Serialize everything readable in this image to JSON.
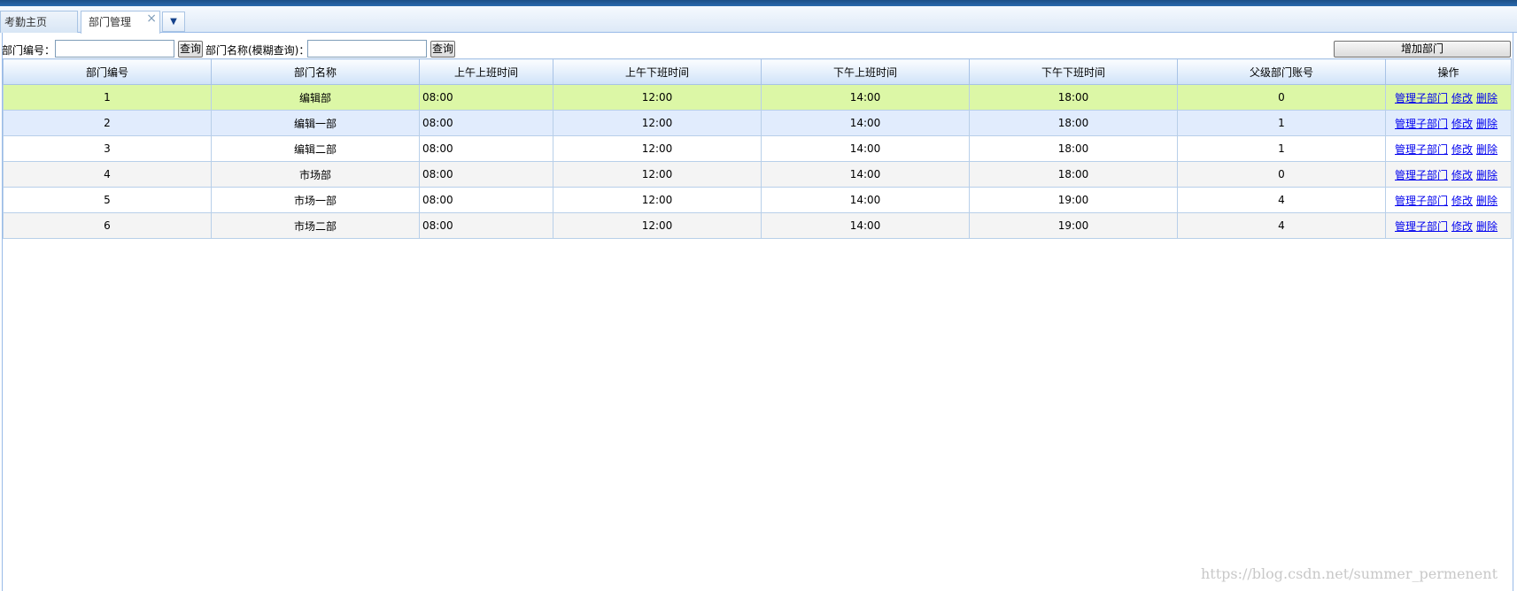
{
  "tabs": [
    {
      "label": "考勤主页",
      "active": false
    },
    {
      "label": "部门管理",
      "active": true
    }
  ],
  "toolbar": {
    "dept_id_label": "部门编号：",
    "dept_id_value": "",
    "search_btn_1": "查询",
    "dept_name_label": "部门名称(模糊查询)：",
    "dept_name_value": "",
    "search_btn_2": "查询",
    "add_btn": "增加部门"
  },
  "table": {
    "columns": [
      "部门编号",
      "部门名称",
      "上午上班时间",
      "上午下班时间",
      "下午上班时间",
      "下午下班时间",
      "父级部门账号",
      "操作"
    ],
    "rows": [
      {
        "id": "1",
        "name": "编辑部",
        "am_in": "08:00",
        "am_out": "12:00",
        "pm_in": "14:00",
        "pm_out": "18:00",
        "parent": "0"
      },
      {
        "id": "2",
        "name": "编辑一部",
        "am_in": "08:00",
        "am_out": "12:00",
        "pm_in": "14:00",
        "pm_out": "18:00",
        "parent": "1"
      },
      {
        "id": "3",
        "name": "编辑二部",
        "am_in": "08:00",
        "am_out": "12:00",
        "pm_in": "14:00",
        "pm_out": "18:00",
        "parent": "1"
      },
      {
        "id": "4",
        "name": "市场部",
        "am_in": "08:00",
        "am_out": "12:00",
        "pm_in": "14:00",
        "pm_out": "18:00",
        "parent": "0"
      },
      {
        "id": "5",
        "name": "市场一部",
        "am_in": "08:00",
        "am_out": "12:00",
        "pm_in": "14:00",
        "pm_out": "19:00",
        "parent": "4"
      },
      {
        "id": "6",
        "name": "市场二部",
        "am_in": "08:00",
        "am_out": "12:00",
        "pm_in": "14:00",
        "pm_out": "19:00",
        "parent": "4"
      }
    ],
    "ops": {
      "manage": "管理子部门",
      "edit": "修改",
      "delete": "删除"
    }
  },
  "watermark": "https://blog.csdn.net/summer_permenent",
  "colors": {
    "selected_row": "#dcf7a6",
    "alt_row": "#e1ecfd",
    "header_border": "#a8c3e6"
  }
}
